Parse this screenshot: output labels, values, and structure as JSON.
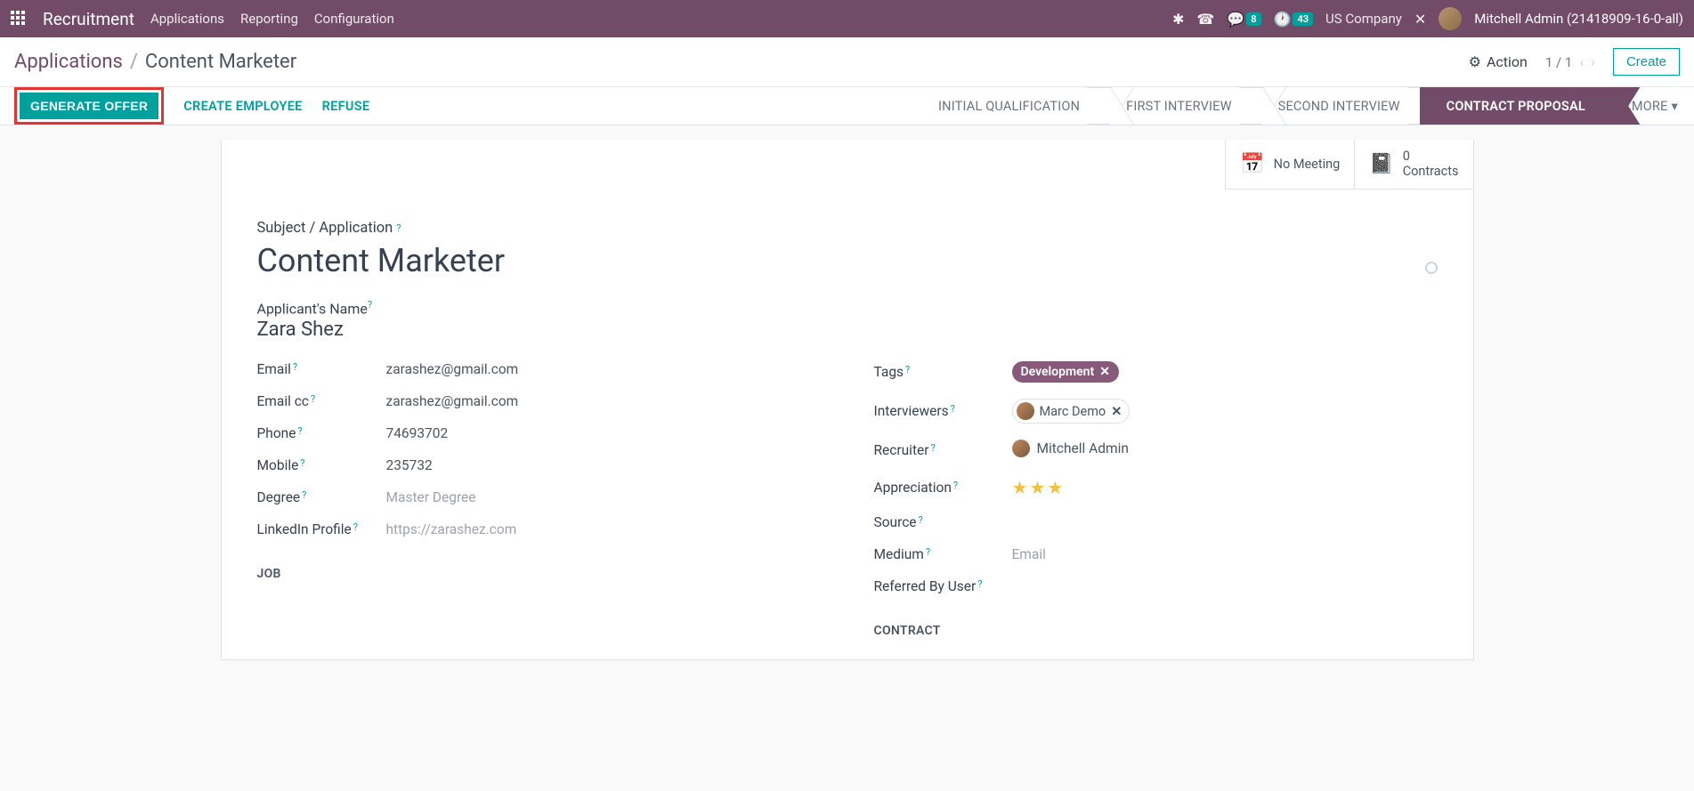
{
  "navbar": {
    "brand": "Recruitment",
    "links": [
      "Applications",
      "Reporting",
      "Configuration"
    ],
    "messages_badge": "8",
    "activities_badge": "43",
    "company": "US Company",
    "user": "Mitchell Admin (21418909-16-0-all)"
  },
  "breadcrumb": {
    "parent": "Applications",
    "current": "Content Marketer"
  },
  "controls": {
    "action": "Action",
    "pager": "1 / 1",
    "create": "Create"
  },
  "buttons": {
    "generate_offer": "GENERATE OFFER",
    "create_employee": "CREATE EMPLOYEE",
    "refuse": "REFUSE"
  },
  "stages": {
    "initial": "INITIAL QUALIFICATION",
    "first": "FIRST INTERVIEW",
    "second": "SECOND INTERVIEW",
    "contract": "CONTRACT PROPOSAL",
    "more": "MORE"
  },
  "stats": {
    "meeting_label": "No Meeting",
    "contracts_count": "0",
    "contracts_label": "Contracts"
  },
  "form": {
    "subject_label": "Subject / Application",
    "title": "Content Marketer",
    "applicant_label": "Applicant's Name",
    "applicant_name": "Zara Shez",
    "left": {
      "email_label": "Email",
      "email": "zarashez@gmail.com",
      "emailcc_label": "Email cc",
      "emailcc": "zarashez@gmail.com",
      "phone_label": "Phone",
      "phone": "74693702",
      "mobile_label": "Mobile",
      "mobile": "235732",
      "degree_label": "Degree",
      "degree": "Master Degree",
      "linkedin_label": "LinkedIn Profile",
      "linkedin": "https://zarashez.com"
    },
    "right": {
      "tags_label": "Tags",
      "tag": "Development",
      "interviewers_label": "Interviewers",
      "interviewer": "Marc Demo",
      "recruiter_label": "Recruiter",
      "recruiter": "Mitchell Admin",
      "appreciation_label": "Appreciation",
      "source_label": "Source",
      "medium_label": "Medium",
      "medium": "Email",
      "referred_label": "Referred By User"
    },
    "sections": {
      "job": "JOB",
      "contract": "CONTRACT"
    }
  }
}
